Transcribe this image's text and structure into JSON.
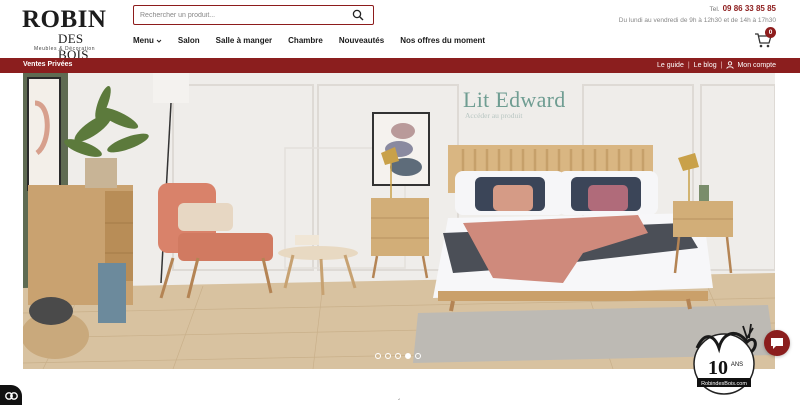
{
  "header": {
    "logo": {
      "main": "ROBIN",
      "sub": "DES BOIS",
      "tagline": "Meubles & Décoration"
    },
    "search": {
      "placeholder": "Rechercher un produit..."
    },
    "nav": [
      {
        "label": "Menu",
        "has_dropdown": true
      },
      {
        "label": "Salon"
      },
      {
        "label": "Salle à manger"
      },
      {
        "label": "Chambre"
      },
      {
        "label": "Nouveautés"
      },
      {
        "label": "Nos offres du moment"
      }
    ],
    "contact": {
      "tel_label": "Tel.",
      "phone": "09 86 33 85 85",
      "hours": "Du lundi au vendredi de 9h à 12h30 et de 14h à 17h30"
    },
    "cart": {
      "count": "0"
    }
  },
  "topbar": {
    "left_link": "Ventes Privées",
    "links": [
      "Le guide",
      "Le blog",
      "Mon compte"
    ],
    "separator": "|"
  },
  "hero": {
    "title": "Lit Edward",
    "subtitle": "Accéder au produit",
    "slides_total": 5,
    "active_slide": 4
  },
  "badge": {
    "years": "10",
    "years_label": "ANS",
    "site": "RobindesBois.com"
  },
  "footer_mark": "´",
  "colors": {
    "brand_red": "#8b1e1e",
    "title_green": "#6f9d92"
  },
  "icons": {
    "search": "search-icon",
    "cart": "cart-icon",
    "user": "user-icon",
    "chat": "chat-icon",
    "cookie": "cookie-icon",
    "chevron": "chevron-down-icon"
  }
}
